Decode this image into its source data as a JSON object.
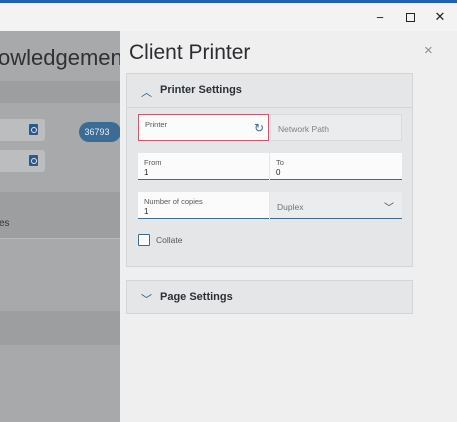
{
  "window": {
    "minimize_glyph": "−",
    "close_glyph": "✕"
  },
  "background_page": {
    "title_fragment": "owledgement",
    "badge": "36793",
    "section_label_fragment": "es"
  },
  "panel": {
    "title": "Client Printer",
    "close_glyph": "×",
    "printer_settings": {
      "header": "Printer Settings",
      "printer": {
        "label": "Printer",
        "value": ""
      },
      "network_path": {
        "placeholder": "Network Path"
      },
      "from": {
        "label": "From",
        "value": "1"
      },
      "to": {
        "label": "To",
        "value": "0"
      },
      "copies": {
        "label": "Number of copies",
        "value": "1"
      },
      "duplex": {
        "value": "Duplex"
      },
      "collate": {
        "label": "Collate",
        "checked": false
      }
    },
    "page_settings": {
      "header": "Page Settings"
    }
  },
  "icons": {
    "expanded": "chevron-up-icon",
    "collapsed": "chevron-down-icon",
    "printer_loading": "refresh-spinner-icon",
    "dropdown": "chevron-down-icon"
  }
}
